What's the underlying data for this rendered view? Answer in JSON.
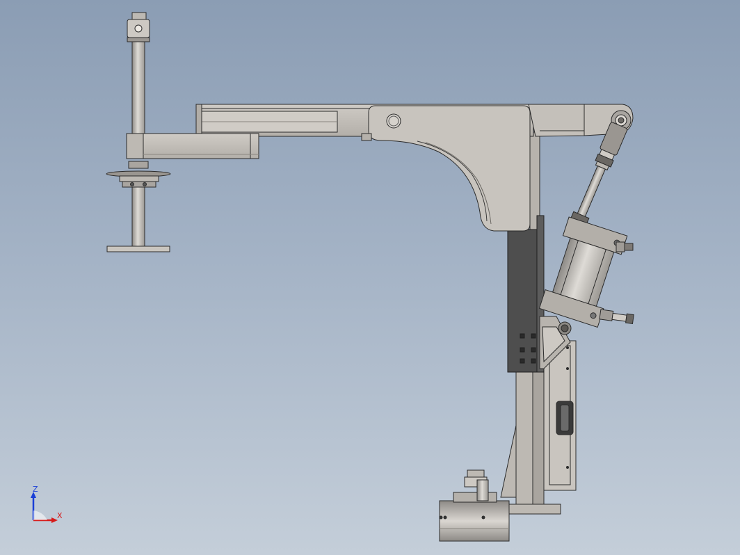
{
  "view": {
    "background_top": "#8b9db4",
    "background_bottom": "#c4ced9",
    "part_color": "#c6c2bb",
    "dark_part_color": "#4a4a4a",
    "edge_color": "#2b2b2b"
  },
  "triad": {
    "z_label": "Z",
    "x_label": "X",
    "z_color": "#1a3fd6",
    "x_color": "#d61a1a"
  }
}
